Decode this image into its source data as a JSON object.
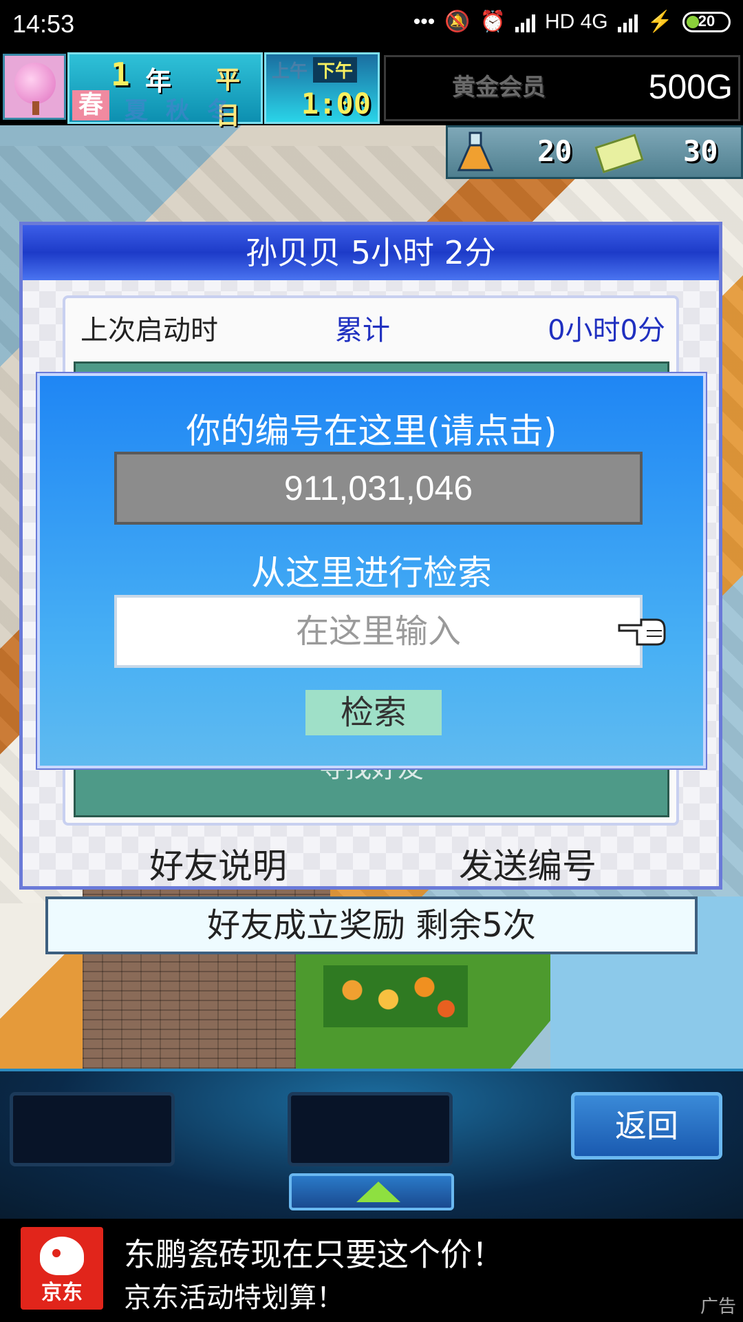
{
  "status_bar": {
    "time": "14:53",
    "network": "HD 4G",
    "battery": "20"
  },
  "hud": {
    "year_num": "1",
    "year_label": "年",
    "weekday": "平日",
    "season_active": "春",
    "seasons_inactive": [
      "夏",
      "秋",
      "冬"
    ],
    "am_label": "上午",
    "pm_label": "下午",
    "clock": "1:00",
    "member_label": "黄金会员",
    "money": "500G",
    "research_points": "20",
    "tickets": "30"
  },
  "friend_dialog": {
    "title": "孙贝贝  5小时 2分",
    "launch_label": "上次启动时",
    "total_label": "累计",
    "total_value": "0小时0分",
    "find_friend": "寻找好友",
    "help_button": "好友说明",
    "send_button": "发送编号",
    "reward_text": "好友成立奖励  剩余5次"
  },
  "id_popup": {
    "title": "你的编号在这里(请点击)",
    "user_id": "911,031,046",
    "search_title": "从这里进行检索",
    "search_placeholder": "在这里输入",
    "search_button": "检索"
  },
  "bottom_bar": {
    "back_button": "返回"
  },
  "ad": {
    "logo_text": "京东",
    "line1": "东鹏瓷砖现在只要这个价！",
    "line2": "京东活动特划算！",
    "tag": "广告"
  },
  "colors": {
    "accent_blue": "#1f86f4",
    "title_bar": "#1d3bc8",
    "gold_text": "#f8f060",
    "ad_brand": "#e1251b"
  }
}
